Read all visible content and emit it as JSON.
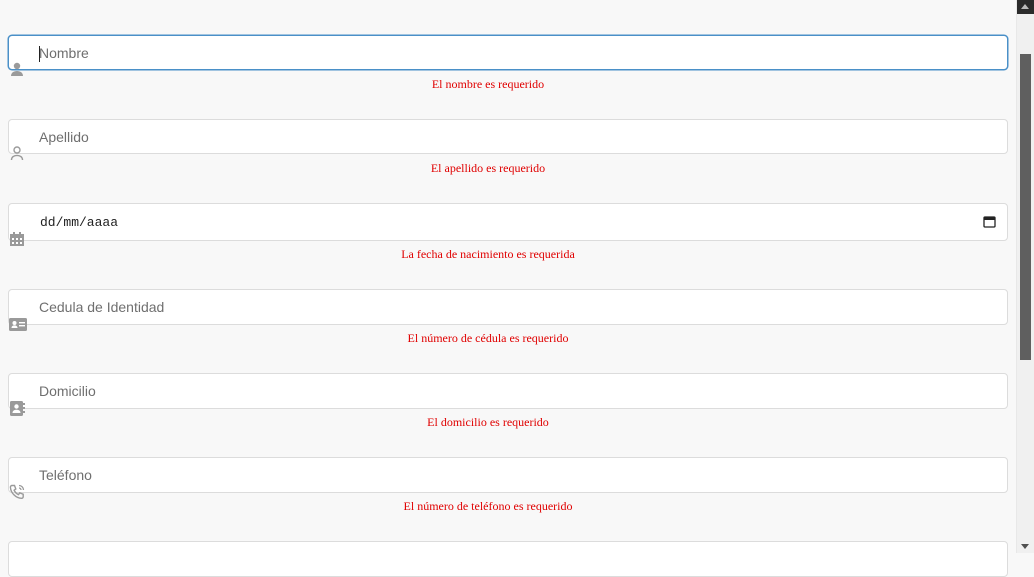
{
  "form": {
    "fields": [
      {
        "placeholder": "Nombre",
        "error": "El nombre es requerido",
        "icon": "user-solid-icon"
      },
      {
        "placeholder": "Apellido",
        "error": "El apellido es requerido",
        "icon": "user-outline-icon"
      },
      {
        "placeholder": "dd/mm/aaaa",
        "error": "La fecha de nacimiento es requerida",
        "icon": "calendar-icon"
      },
      {
        "placeholder": "Cedula de Identidad",
        "error": "El número de cédula es requerido",
        "icon": "id-card-icon"
      },
      {
        "placeholder": "Domicilio",
        "error": "El domicilio es requerido",
        "icon": "address-book-icon"
      },
      {
        "placeholder": "Teléfono",
        "error": "El número de teléfono es requerido",
        "icon": "phone-icon"
      }
    ]
  },
  "colors": {
    "error": "#e00000",
    "focus_border": "#4a90c8",
    "icon": "#9a9a9a"
  }
}
